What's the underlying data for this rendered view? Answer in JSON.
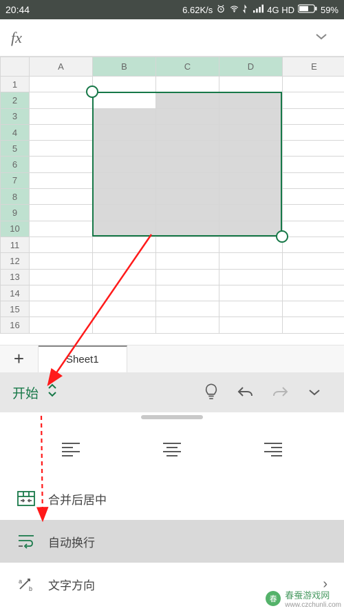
{
  "status_bar": {
    "time": "20:44",
    "speed": "6.62K/s",
    "net_text": "4G HD",
    "battery_pct": "59%"
  },
  "formula_bar": {
    "fx_label": "fx"
  },
  "grid": {
    "col_headers": [
      "A",
      "B",
      "C",
      "D",
      "E"
    ],
    "row_headers": [
      "1",
      "2",
      "3",
      "4",
      "5",
      "6",
      "7",
      "8",
      "9",
      "10",
      "11",
      "12",
      "13",
      "14",
      "15",
      "16"
    ],
    "selection": {
      "start": "B2",
      "end": "D10",
      "active": "B2"
    },
    "selected_cols": [
      "B",
      "C",
      "D"
    ],
    "selected_rows": [
      "2",
      "3",
      "4",
      "5",
      "6",
      "7",
      "8",
      "9",
      "10"
    ]
  },
  "sheet_tabs": {
    "add_label": "+",
    "tabs": [
      {
        "label": "Sheet1",
        "active": true
      }
    ]
  },
  "ribbon": {
    "title": "开始",
    "items": {
      "merge_center": "合并后居中",
      "wrap_text": "自动换行",
      "text_direction": "文字方向"
    }
  },
  "watermark": {
    "name": "春蚕游戏网",
    "url": "www.czchunli.com"
  },
  "colors": {
    "accent": "#177848"
  }
}
